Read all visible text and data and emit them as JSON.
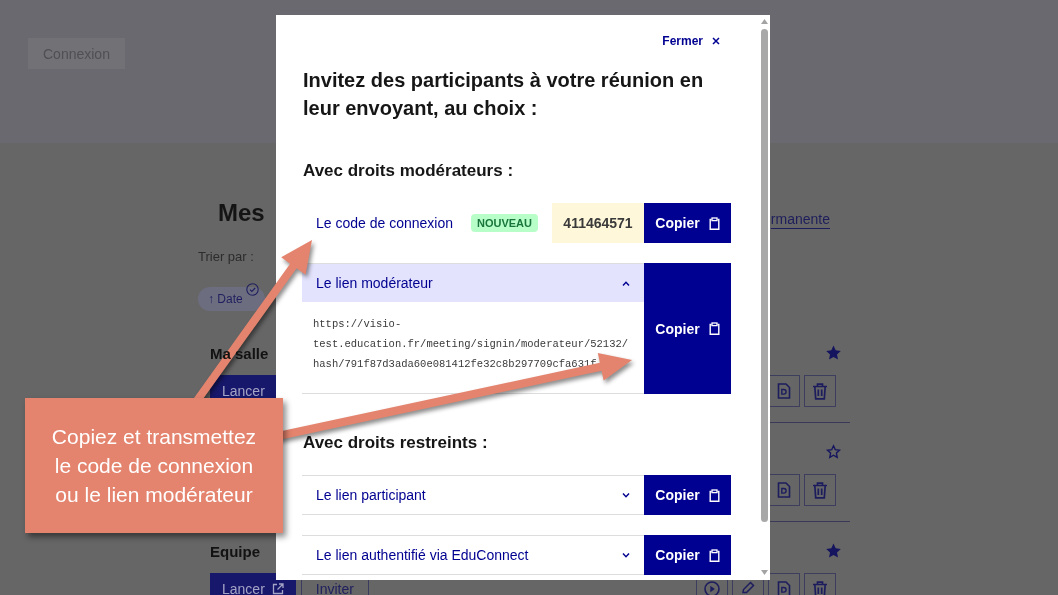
{
  "page": {
    "login_button": "Connexion",
    "title": "Mes",
    "header_link": "rmanente",
    "sort_label": "Trier par :",
    "sort_options": [
      {
        "label": "↑ Date",
        "selected": true
      }
    ],
    "rooms": [
      {
        "title": "Ma salle",
        "starred": true,
        "buttons": [
          {
            "kind": "launch",
            "label": "Lancer"
          }
        ],
        "tools": [
          {
            "kind": "document"
          },
          {
            "kind": "delete"
          }
        ]
      },
      {
        "starred": false,
        "tools": [
          {
            "kind": "document"
          },
          {
            "kind": "delete"
          }
        ]
      },
      {
        "title": "Equipe",
        "starred": true,
        "buttons": [
          {
            "kind": "launch",
            "label": "Lancer",
            "external_icon": true
          },
          {
            "kind": "invite",
            "label": "Inviter"
          }
        ],
        "tools": [
          {
            "kind": "play"
          },
          {
            "kind": "edit"
          },
          {
            "kind": "document"
          },
          {
            "kind": "delete"
          }
        ]
      }
    ]
  },
  "modal": {
    "close_label": "Fermer",
    "title": "Invitez des participants à votre réunion en leur envoyant, au choix :",
    "sections": [
      {
        "heading": "Avec droits modérateurs :",
        "items": [
          {
            "kind": "code",
            "label": "Le code de connexion",
            "badge": "NOUVEAU",
            "code": "411464571",
            "button": "Copier"
          },
          {
            "kind": "link",
            "label": "Le lien modérateur",
            "expanded": true,
            "url_lines": [
              "https://visio-",
              "test.education.fr/meeting/signin/moderateur/52132/",
              "hash/791f87d3ada60e081412fe32c8b297709cfa631f"
            ],
            "button": "Copier"
          }
        ]
      },
      {
        "heading": "Avec droits restreints :",
        "items": [
          {
            "kind": "link",
            "label": "Le lien participant",
            "expanded": false,
            "button": "Copier"
          },
          {
            "kind": "link",
            "label": "Le lien authentifié via EduConnect",
            "expanded": false,
            "button": "Copier"
          }
        ]
      }
    ]
  },
  "annotation": {
    "lines": [
      "Copiez et transmettez",
      "le code de connexion",
      "ou le lien modérateur"
    ]
  }
}
